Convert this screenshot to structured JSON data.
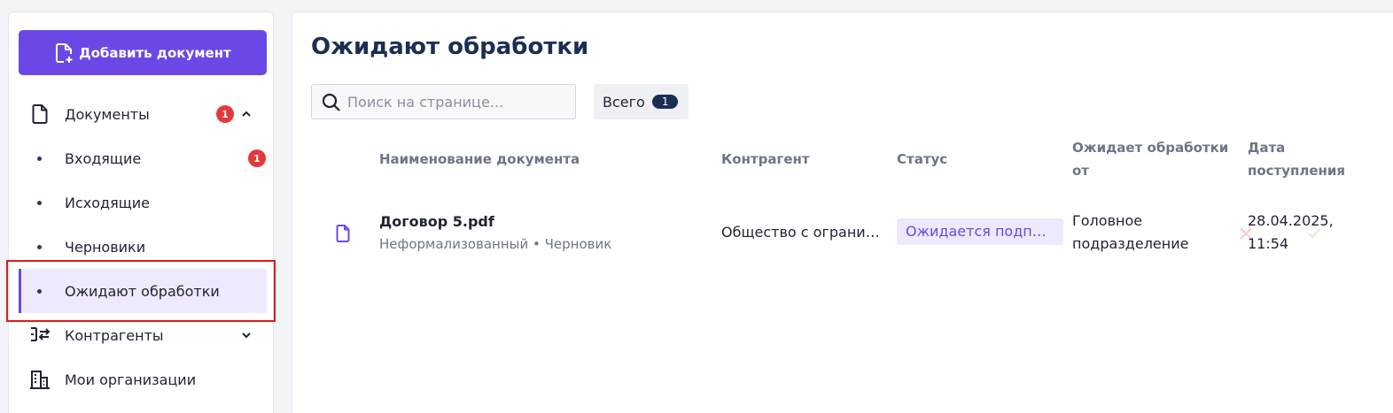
{
  "sidebar": {
    "add_button": "Добавить документ",
    "items": [
      {
        "label": "Документы",
        "badge": "1"
      },
      {
        "label": "Входящие",
        "badge": "1"
      },
      {
        "label": "Исходящие"
      },
      {
        "label": "Черновики"
      },
      {
        "label": "Ожидают обработки"
      },
      {
        "label": "Контрагенты"
      },
      {
        "label": "Мои организации"
      }
    ]
  },
  "main": {
    "title": "Ожидают обработки",
    "search": {
      "placeholder": "Поиск на странице..."
    },
    "total": {
      "label": "Всего",
      "count": "1"
    },
    "columns": {
      "name": "Наименование документа",
      "counterparty": "Контрагент",
      "status": "Статус",
      "awaits_from_1": "Ожидает обработки",
      "awaits_from_2": "от",
      "date_1": "Дата",
      "date_2": "поступления"
    },
    "rows": [
      {
        "name": "Договор 5.pdf",
        "sub": "Неформализованный • Черновик",
        "counterparty": "Общество с ограниченной ответственностью",
        "status": "Ожидается подписание",
        "awaits_from_1": "Головное",
        "awaits_from_2": "подразделение",
        "date_1": "28.04.2025,",
        "date_2": "11:54"
      }
    ]
  },
  "colors": {
    "accent": "#6b48e6",
    "badge": "#e5383b",
    "title": "#1b2e54"
  }
}
